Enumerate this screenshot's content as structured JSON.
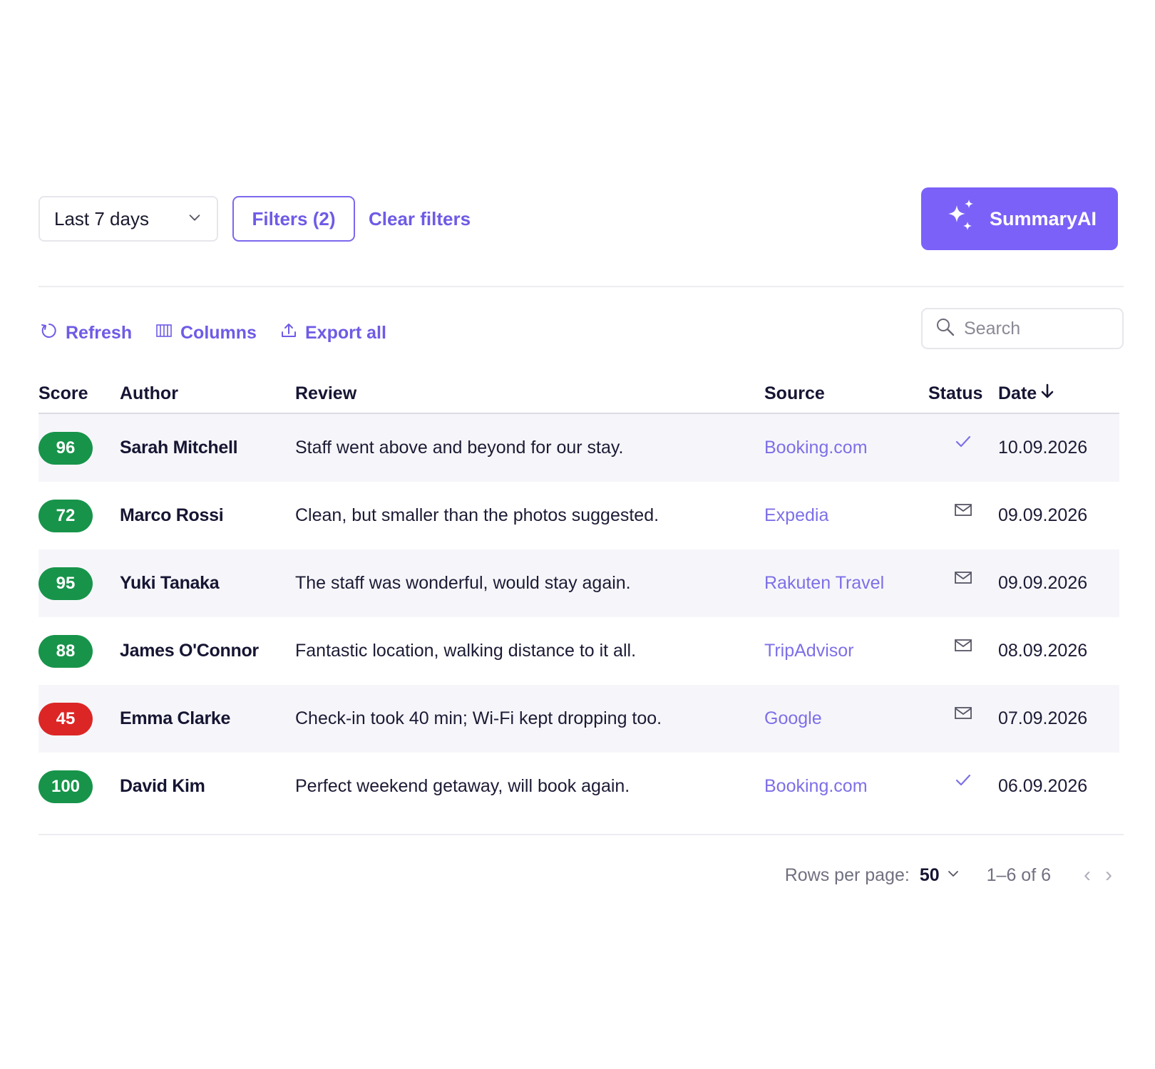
{
  "top_bar": {
    "date_range": "Last 7 days",
    "filters_label": "Filters (2)",
    "clear_filters_label": "Clear filters",
    "summary_ai_label": "SummaryAI",
    "icons": {
      "date_range": "chevron-down-icon",
      "summary_ai": "sparkles-icon"
    }
  },
  "toolbar": {
    "refresh_label": "Refresh",
    "columns_label": "Columns",
    "export_label": "Export all",
    "search_placeholder": "Search",
    "icons": {
      "refresh": "refresh-icon",
      "columns": "columns-icon",
      "export": "upload-icon",
      "search": "search-icon"
    }
  },
  "table": {
    "headers": {
      "score": "Score",
      "author": "Author",
      "review": "Review",
      "source": "Source",
      "status": "Status",
      "date": "Date"
    },
    "sort": {
      "column": "date",
      "direction": "descending",
      "icon": "arrow-down-icon"
    },
    "rows": [
      {
        "score": "96",
        "score_color": "#17944a",
        "author": "Sarah Mitchell",
        "review": "Staff went above and beyond for our stay.",
        "source": "Booking.com",
        "status": "check-icon",
        "date": "10.09.2026"
      },
      {
        "score": "72",
        "score_color": "#17944a",
        "author": "Marco Rossi",
        "review": "Clean, but smaller than the photos suggested.",
        "source": "Expedia",
        "status": "envelope-icon",
        "date": "09.09.2026"
      },
      {
        "score": "95",
        "score_color": "#17944a",
        "author": "Yuki Tanaka",
        "review": "The staff was wonderful, would stay again.",
        "source": "Rakuten Travel",
        "status": "envelope-icon",
        "date": "09.09.2026"
      },
      {
        "score": "88",
        "score_color": "#17944a",
        "author": "James O'Connor",
        "review": "Fantastic location, walking distance to it all.",
        "source": "TripAdvisor",
        "status": "envelope-icon",
        "date": "08.09.2026"
      },
      {
        "score": "45",
        "score_color": "#dc2626",
        "author": "Emma Clarke",
        "review": "Check-in took 40 min; Wi-Fi kept dropping too.",
        "source": "Google",
        "status": "envelope-icon",
        "date": "07.09.2026"
      },
      {
        "score": "100",
        "score_color": "#17944a",
        "author": "David Kim",
        "review": "Perfect weekend getaway, will book again.",
        "source": "Booking.com",
        "status": "check-icon",
        "date": "06.09.2026"
      }
    ]
  },
  "pagination": {
    "rows_per_page_label": "Rows per page:",
    "rows_per_page_value": "50",
    "range_label": "1–6 of 6",
    "prev_symbol": "‹",
    "next_symbol": "›"
  },
  "colors": {
    "accent": "#7b61f8",
    "link": "#6e5be6",
    "positive": "#17944a",
    "negative": "#dc2626",
    "row_alt": "#f6f6fa"
  }
}
